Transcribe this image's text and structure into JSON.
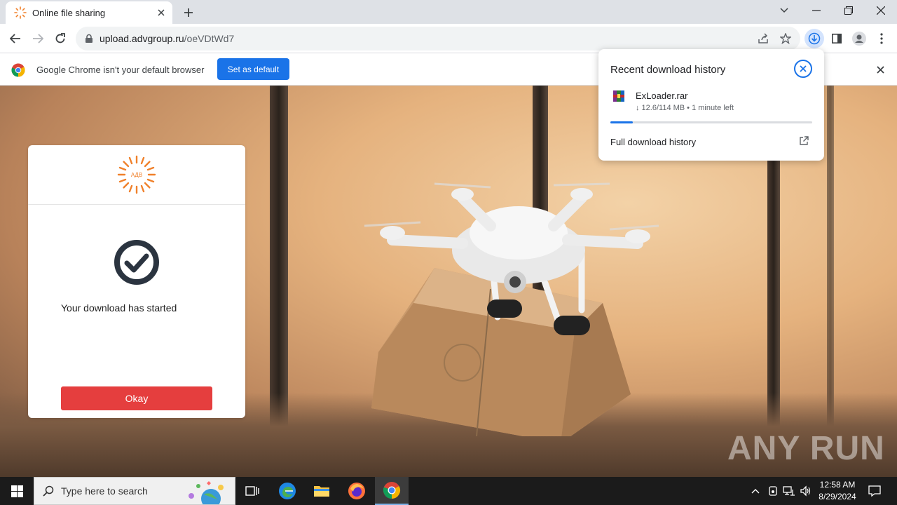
{
  "tab": {
    "title": "Online file sharing"
  },
  "omnibox": {
    "host": "upload.advgroup.ru",
    "path": "/oeVDtWd7"
  },
  "infobar": {
    "message": "Google Chrome isn't your default browser",
    "button": "Set as default"
  },
  "card": {
    "logo_text": "АДВ",
    "message": "Your download has started",
    "button": "Okay"
  },
  "download_bubble": {
    "title": "Recent download history",
    "file_name": "ExLoader.rar",
    "status": "↓ 12.6/114 MB • 1 minute left",
    "progress_fraction": 0.11,
    "full_history": "Full download history"
  },
  "watermark": "ANY RUN",
  "taskbar": {
    "search_placeholder": "Type here to search",
    "time": "12:58 AM",
    "date": "8/29/2024"
  },
  "colors": {
    "accent": "#1a73e8",
    "okay_button": "#e53e3e",
    "logo_orange": "#f0802a",
    "taskbar": "#1b1b1b"
  }
}
